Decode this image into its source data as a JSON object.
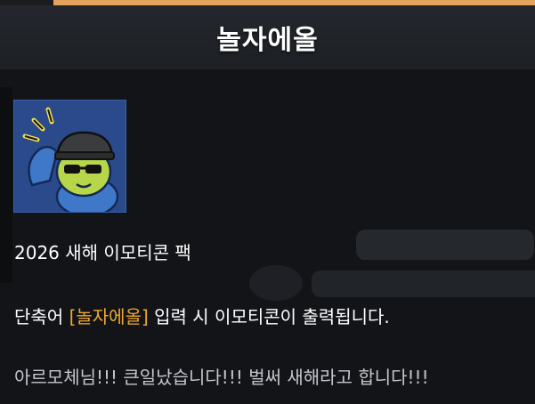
{
  "window": {
    "title": "놀자에올"
  },
  "emoticon": {
    "icon": "emoticon-character-icon",
    "background_color": "#2b4a8c"
  },
  "description": {
    "pack_name": "2026 새해 이모티콘 팩",
    "shortcut_prefix": "단축어 ",
    "shortcut_keyword": "[놀자에올]",
    "shortcut_suffix": " 입력 시 이모티콘이 출력됩니다.",
    "flavor_text": "아르모체님!!! 큰일났습니다!!! 벌써 새해라고 합니다!!!"
  },
  "colors": {
    "accent": "#e3a35a",
    "highlight": "#f0a830",
    "text": "#ffffff",
    "muted_text": "#c3c6cc"
  }
}
